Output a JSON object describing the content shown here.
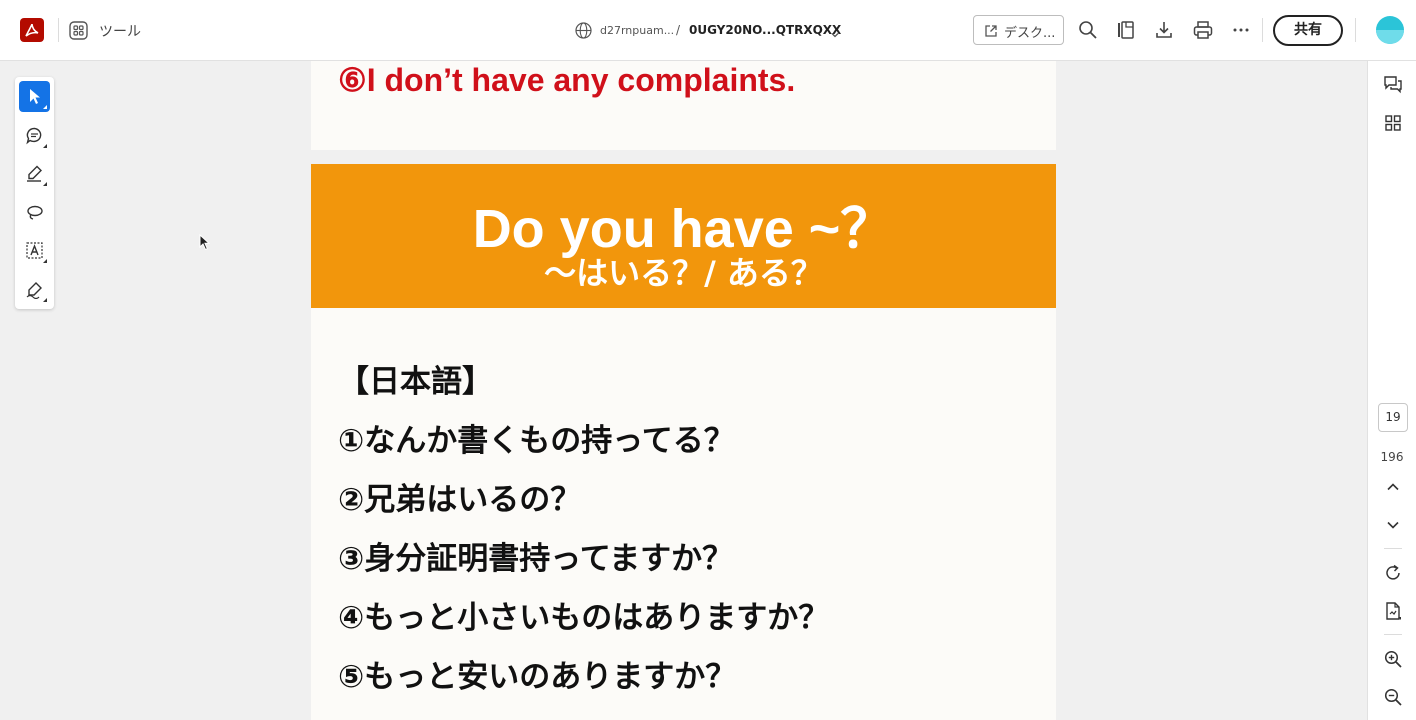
{
  "toolbar": {
    "tools_label": "ツール",
    "path_host": "d27rnpuam...",
    "path_separator": "/",
    "path_file": "0UGY20NO...QTRXQXX",
    "desktop_button": "デスク...",
    "share_button": "共有"
  },
  "icons": {
    "app_logo": "acrobat-logo-icon",
    "tools": "tools-grid-icon",
    "globe": "globe-icon",
    "path_chevron": "chevron-down-icon",
    "open_desktop": "open-external-icon",
    "search": "search-icon",
    "organize": "pages-icon",
    "download": "download-icon",
    "print": "print-icon",
    "more": "more-icon",
    "left_tools": [
      "select-pointer-icon",
      "comment-icon",
      "highlight-pen-icon",
      "draw-lasso-icon",
      "text-box-icon",
      "sign-icon"
    ],
    "right_rail": [
      "comments-panel-icon",
      "thumbnails-icon",
      "page-up-icon",
      "page-down-icon",
      "rotate-icon",
      "page-file-icon",
      "zoom-in-icon",
      "zoom-out-icon"
    ]
  },
  "colors": {
    "accent": "#1473e6",
    "banner": "#f2960c",
    "heading_red": "#d0101a",
    "acrobat_red": "#b30b00"
  },
  "pagination": {
    "current_page": "19",
    "total_pages": "196"
  },
  "document": {
    "previous_page_line": "⑥I don’t have any complaints.",
    "banner_title": "Do you have ~？",
    "banner_subtitle": "～はいる？/ ある？",
    "section_heading": "【日本語】",
    "items": [
      "①なんか書くもの持ってる？",
      "②兄弟はいるの？",
      "③身分証明書持ってますか？",
      "④もっと小さいものはありますか？",
      "⑤もっと安いのありますか？"
    ]
  }
}
